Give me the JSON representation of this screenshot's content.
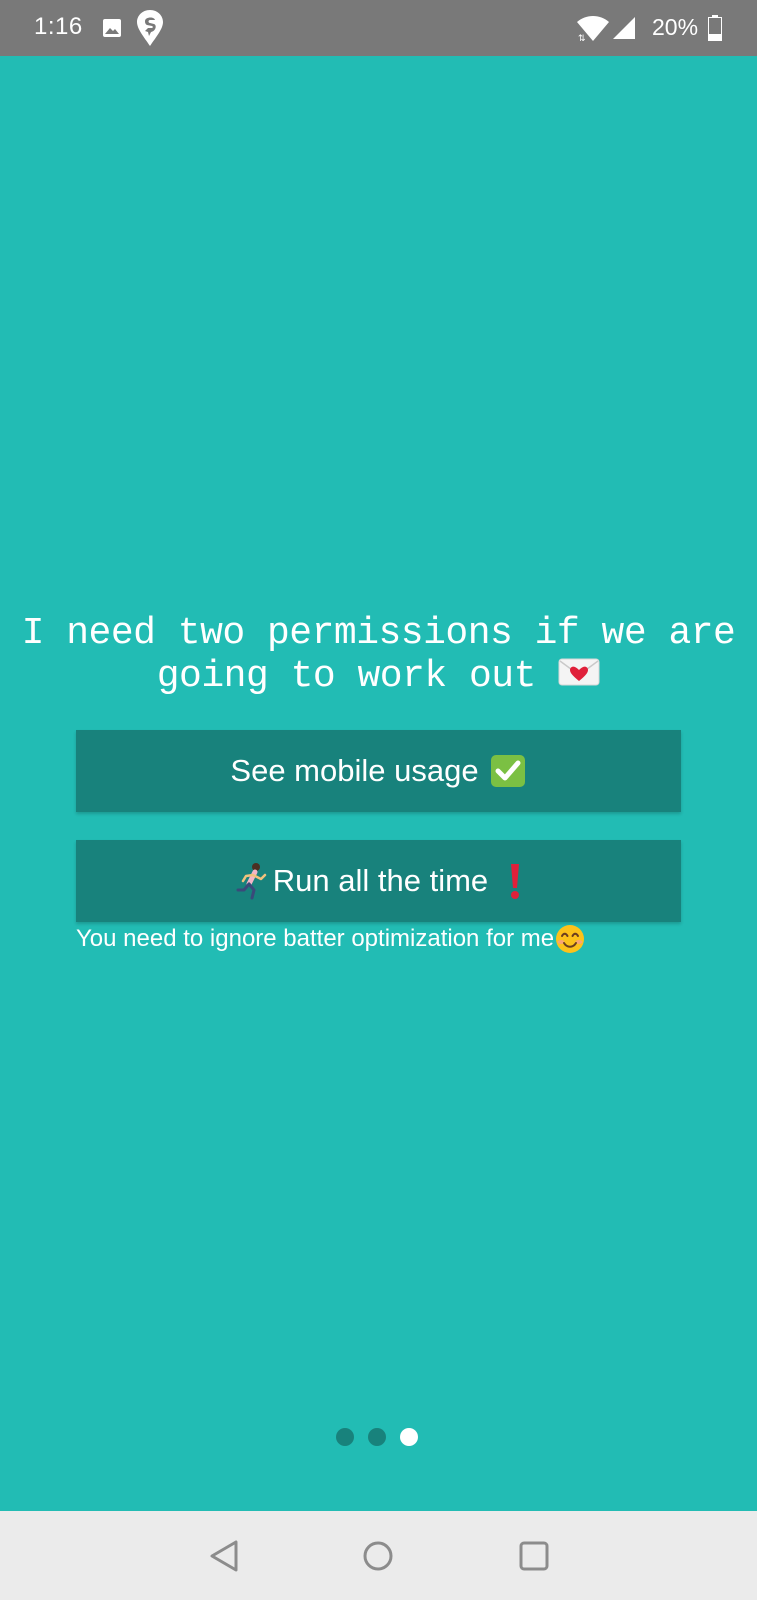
{
  "status_bar": {
    "time": "1:16",
    "battery_percent": "20%",
    "icons": [
      "gallery-icon",
      "swiggy-icon",
      "wifi-icon",
      "signal-icon",
      "battery-icon"
    ]
  },
  "headline": {
    "text": "I need two permissions if we are going to work out",
    "icon": "love-letter-icon"
  },
  "buttons": {
    "mobile_usage": {
      "label": "See mobile usage",
      "icon": "check-mark-icon"
    },
    "run_all_time": {
      "label": "Run all the time",
      "leading_icon": "runner-icon",
      "trailing_icon": "exclamation-icon"
    }
  },
  "hint": {
    "text": "You need to ignore batter optimization for me",
    "icon": "smile-icon"
  },
  "pager": {
    "count": 3,
    "active_index": 2
  },
  "nav_bar": {
    "buttons": [
      "back",
      "home",
      "recents"
    ]
  },
  "colors": {
    "background": "#22bcb4",
    "button": "#18827c",
    "status_bar": "#797979",
    "nav_bar": "#ebebeb",
    "text": "#ffffff"
  }
}
